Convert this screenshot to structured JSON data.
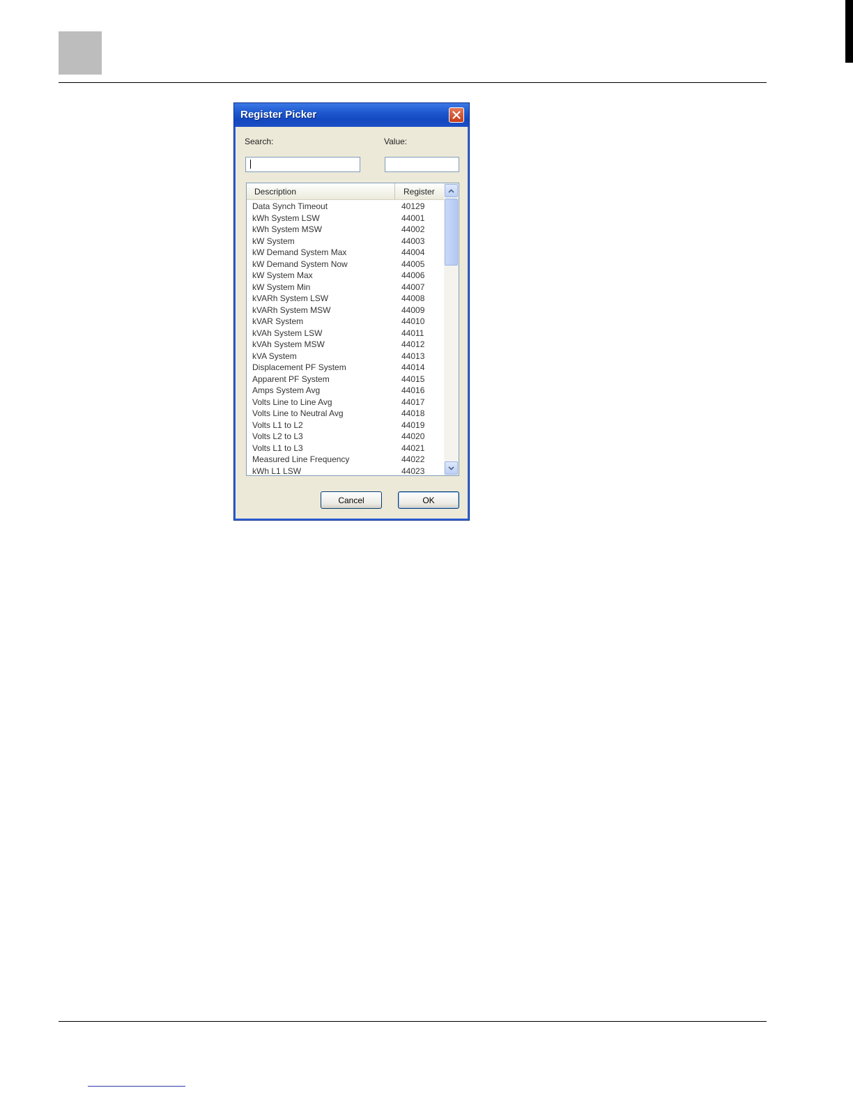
{
  "dialog": {
    "title": "Register Picker",
    "search_label": "Search:",
    "search_value": "",
    "value_label": "Value:",
    "value_value": "",
    "columns": {
      "description": "Description",
      "register": "Register"
    },
    "rows": [
      {
        "description": "Data Synch Timeout",
        "register": "40129"
      },
      {
        "description": "kWh System LSW",
        "register": "44001"
      },
      {
        "description": "kWh System MSW",
        "register": "44002"
      },
      {
        "description": "kW System",
        "register": "44003"
      },
      {
        "description": "kW Demand System Max",
        "register": "44004"
      },
      {
        "description": "kW Demand System Now",
        "register": "44005"
      },
      {
        "description": "kW System Max",
        "register": "44006"
      },
      {
        "description": "kW System Min",
        "register": "44007"
      },
      {
        "description": "kVARh System LSW",
        "register": "44008"
      },
      {
        "description": "kVARh System MSW",
        "register": "44009"
      },
      {
        "description": "kVAR System",
        "register": "44010"
      },
      {
        "description": "kVAh System LSW",
        "register": "44011"
      },
      {
        "description": "kVAh System MSW",
        "register": "44012"
      },
      {
        "description": "kVA System",
        "register": "44013"
      },
      {
        "description": "Displacement PF System",
        "register": "44014"
      },
      {
        "description": "Apparent PF System",
        "register": "44015"
      },
      {
        "description": "Amps System Avg",
        "register": "44016"
      },
      {
        "description": "Volts Line to Line Avg",
        "register": "44017"
      },
      {
        "description": "Volts Line to Neutral Avg",
        "register": "44018"
      },
      {
        "description": "Volts L1 to L2",
        "register": "44019"
      },
      {
        "description": "Volts L2 to L3",
        "register": "44020"
      },
      {
        "description": "Volts L1 to L3",
        "register": "44021"
      },
      {
        "description": "Measured Line Frequency",
        "register": "44022"
      },
      {
        "description": "kWh L1 LSW",
        "register": "44023"
      }
    ],
    "cancel_label": "Cancel",
    "ok_label": "OK"
  },
  "colors": {
    "titlebar": "#1e58cf",
    "dialog_bg": "#ece9d8",
    "close_button": "#c73b18"
  },
  "icons": [
    "close-icon",
    "scroll-up-arrow-icon",
    "scroll-down-arrow-icon"
  ]
}
